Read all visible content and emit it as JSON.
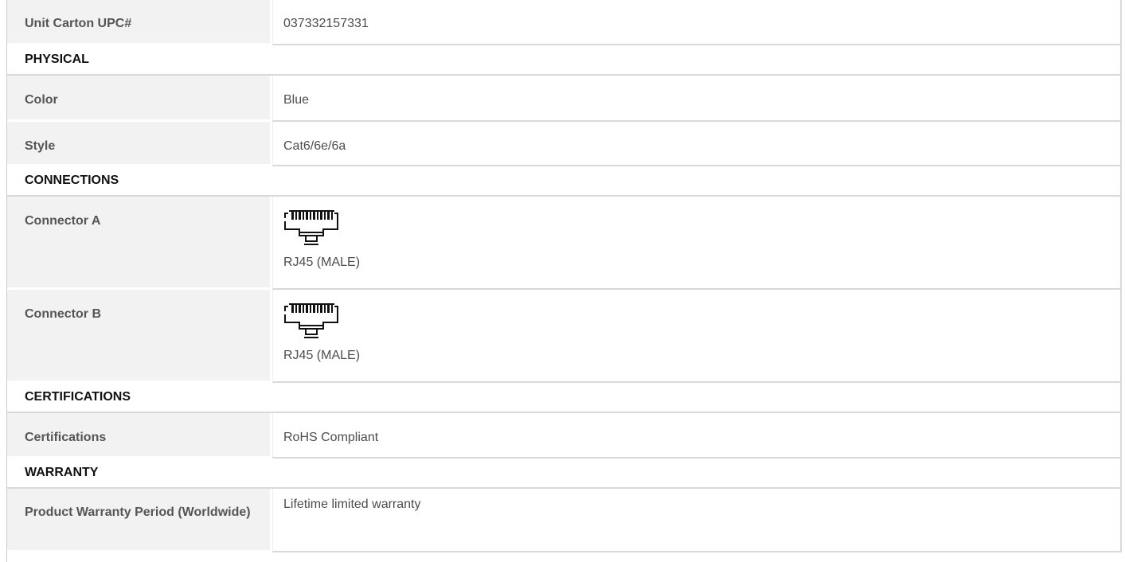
{
  "specs": {
    "upc": {
      "label": "Unit Carton UPC#",
      "value": "037332157331"
    },
    "physical": {
      "heading": "PHYSICAL",
      "color": {
        "label": "Color",
        "value": "Blue"
      },
      "style": {
        "label": "Style",
        "value": "Cat6/6e/6a"
      }
    },
    "connections": {
      "heading": "CONNECTIONS",
      "connector_a": {
        "label": "Connector A",
        "icon": "rj45-connector-icon",
        "value": "RJ45 (MALE)"
      },
      "connector_b": {
        "label": "Connector B",
        "icon": "rj45-connector-icon",
        "value": "RJ45 (MALE)"
      }
    },
    "certifications": {
      "heading": "CERTIFICATIONS",
      "certifications": {
        "label": "Certifications",
        "value": "RoHS Compliant"
      }
    },
    "warranty": {
      "heading": "WARRANTY",
      "period": {
        "label": "Product Warranty Period (Worldwide)",
        "value": "Lifetime limited warranty"
      }
    }
  },
  "colors": {
    "label_bg": "#f2f2f2",
    "border": "#d9d9d9",
    "text": "#333333"
  }
}
